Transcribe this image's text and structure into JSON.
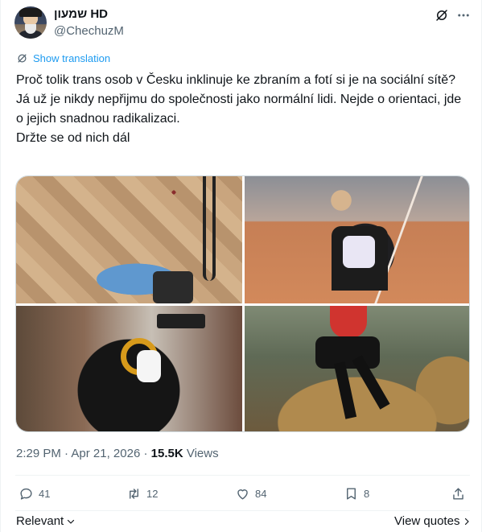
{
  "author": {
    "display_name": "שמעון HD",
    "handle": "@ChechuzM"
  },
  "translate_label": "Show translation",
  "tweet": {
    "lines": [
      "Proč tolik trans osob v Česku inklinuje ke zbraním a fotí si je na sociální sítě?",
      "Já už je nikdy nepřijmu do společnosti jako normální lidi. Nejde o orientaci, jde o jejich snadnou radikalizaci.",
      "Držte se od nich dál"
    ]
  },
  "meta": {
    "time": "2:29 PM",
    "sep1": "·",
    "date": "Apr 21, 2026",
    "sep2": "·",
    "views_count": "15.5K",
    "views_label": "Views"
  },
  "actions": {
    "replies": "41",
    "reposts": "12",
    "likes": "84",
    "bookmarks": "8"
  },
  "footer": {
    "sort_label": "Relevant",
    "view_quotes": "View quotes"
  },
  "icons": {
    "grok": "grok-icon",
    "more": "more-icon",
    "translate": "translate-icon",
    "reply": "reply-icon",
    "repost": "repost-icon",
    "like": "heart-icon",
    "bookmark": "bookmark-icon",
    "share": "share-icon"
  },
  "colors": {
    "accent": "#1d9bf0",
    "secondary_text": "#536471",
    "primary_text": "#0f1419"
  }
}
